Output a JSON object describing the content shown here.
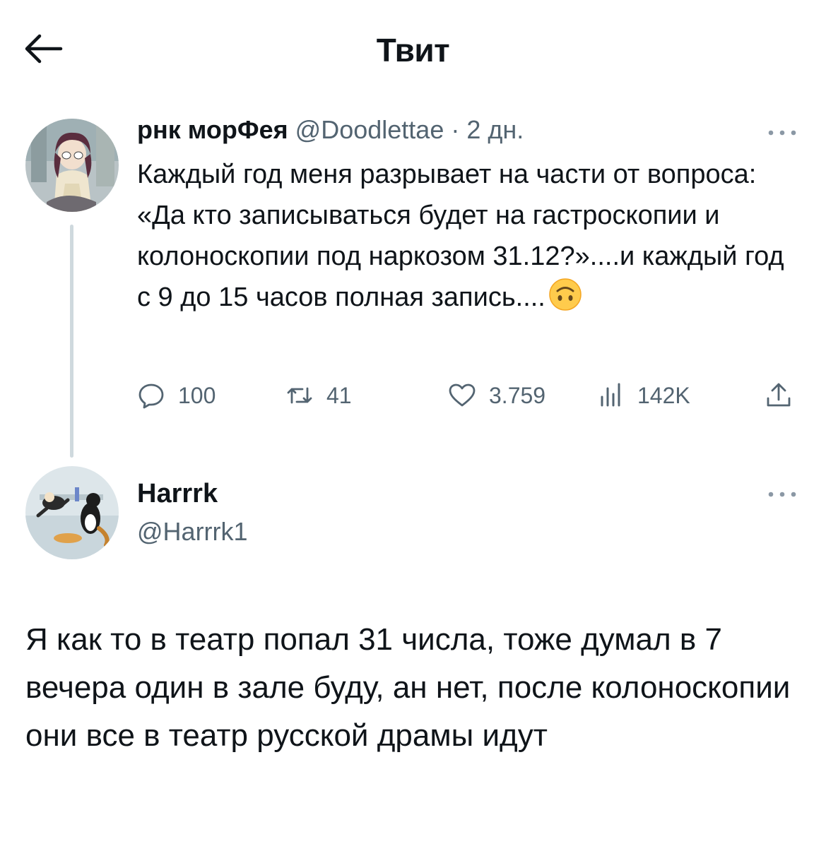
{
  "header": {
    "title": "Твит",
    "back_icon": "arrow-left-icon"
  },
  "tweet1": {
    "name": "рнк морФея",
    "handle": "@Doodlettae",
    "separator": "·",
    "time": "2 дн.",
    "text": "Каждый год меня разрывает на части от вопроса: «Да кто записываться будет на гастроскопии и колоноскопии под наркозом 31.12?»....и каждый год с 9 до 15 часов полная запись....",
    "emoji": "upside-down-face",
    "stats": {
      "replies": "100",
      "retweets": "41",
      "likes": "3.759",
      "views": "142K"
    },
    "icons": {
      "reply": "comment-icon",
      "retweet": "retweet-icon",
      "like": "heart-icon",
      "views": "views-chart-icon",
      "share": "share-icon",
      "more": "more-horizontal-icon"
    }
  },
  "tweet2": {
    "name": "Harrrk",
    "handle": "@Harrrk1",
    "text": "Я как то в театр попал 31 числа, тоже думал в 7 вечера один в зале буду, ан нет, после колоноскопии они все в театр русской драмы идут"
  },
  "colors": {
    "text_primary": "#0f1419",
    "text_secondary": "#536471",
    "thread_line": "#cfd9de",
    "emoji_yellow": "#ffcb4c"
  }
}
